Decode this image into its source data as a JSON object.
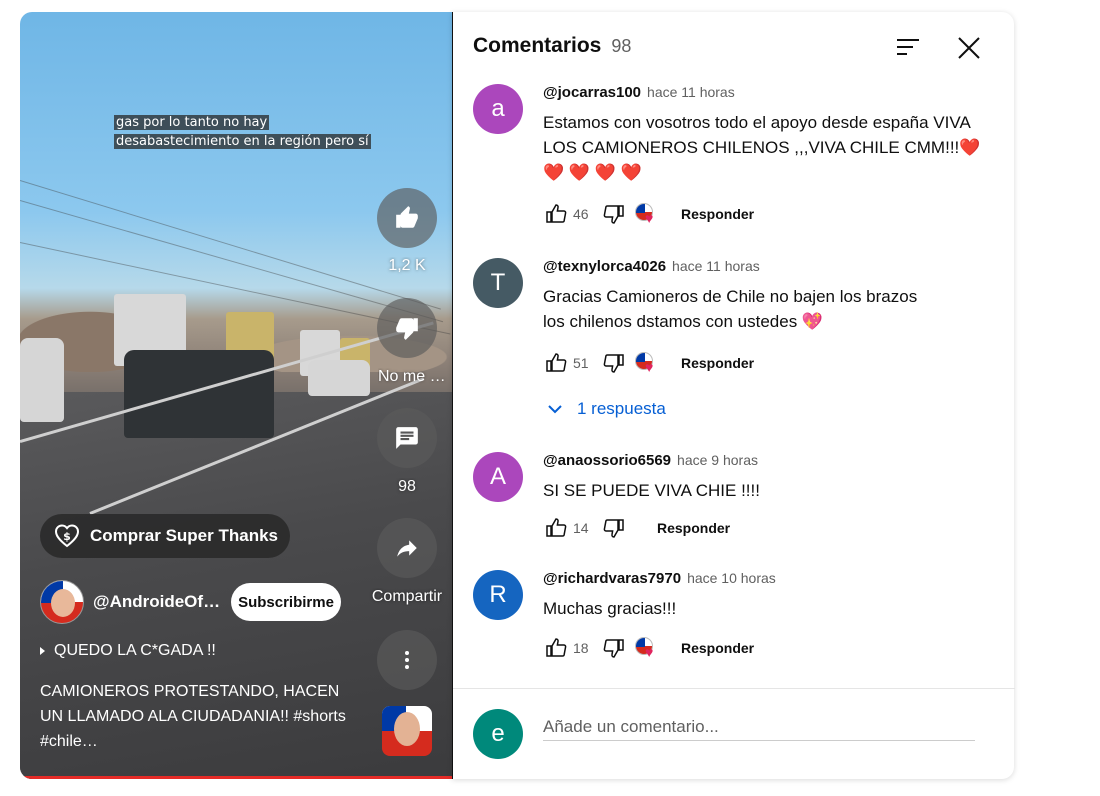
{
  "video": {
    "caption_lines": [
      "gas por lo tanto no hay",
      "desabastecimiento en la región pero sí"
    ],
    "actions": {
      "like_count": "1,2 K",
      "dislike_label": "No me gusta",
      "comments_count": "98",
      "share_label": "Compartir"
    },
    "super_thanks_label": "Comprar Super Thanks",
    "channel_name": "@AndroideOfficial",
    "subscribe_label": "Subscribirme",
    "sound_title": "QUEDO LA C*GADA !!",
    "description": "CAMIONEROS PROTESTANDO, HACEN UN LLAMADO ALA CIUDADANIA!! #shorts #chile…",
    "progress_color": "#e52b27"
  },
  "comments_panel": {
    "title": "Comentarios",
    "count": "98",
    "reply_label": "Responder",
    "replies_toggle": "1 respuesta",
    "add_placeholder": "Añade un comentario...",
    "me_initial": "e",
    "me_color": "#00897b",
    "comments": [
      {
        "initial": "a",
        "avatar_color": "#ab47bc",
        "author": "@jocarras100",
        "time": "hace 11 horas",
        "text": "Estamos con vosotros todo el apoyo desde españa VIVA LOS CAMIONEROS CHILENOS ,,,VIVA CHILE CMM!!!❤️ ❤️ ❤️ ❤️ ❤️",
        "likes": "46",
        "creator_heart": true
      },
      {
        "initial": "T",
        "avatar_color": "#455a64",
        "author": "@texnylorca4026",
        "time": "hace 11 horas",
        "text": "Gracias Camioneros de Chile    no bajen los brazos los chilenos dstamos con ustedes 💖",
        "likes": "51",
        "creator_heart": true
      },
      {
        "initial": "A",
        "avatar_color": "#ab47bc",
        "author": "@anaossorio6569",
        "time": "hace 9 horas",
        "text": "SI SE PUEDE VIVA CHIE !!!!",
        "likes": "14",
        "creator_heart": false
      },
      {
        "initial": "R",
        "avatar_color": "#1565c0",
        "author": "@richardvaras7970",
        "time": "hace 10 horas",
        "text": "Muchas gracias!!!",
        "likes": "18",
        "creator_heart": true
      }
    ]
  }
}
